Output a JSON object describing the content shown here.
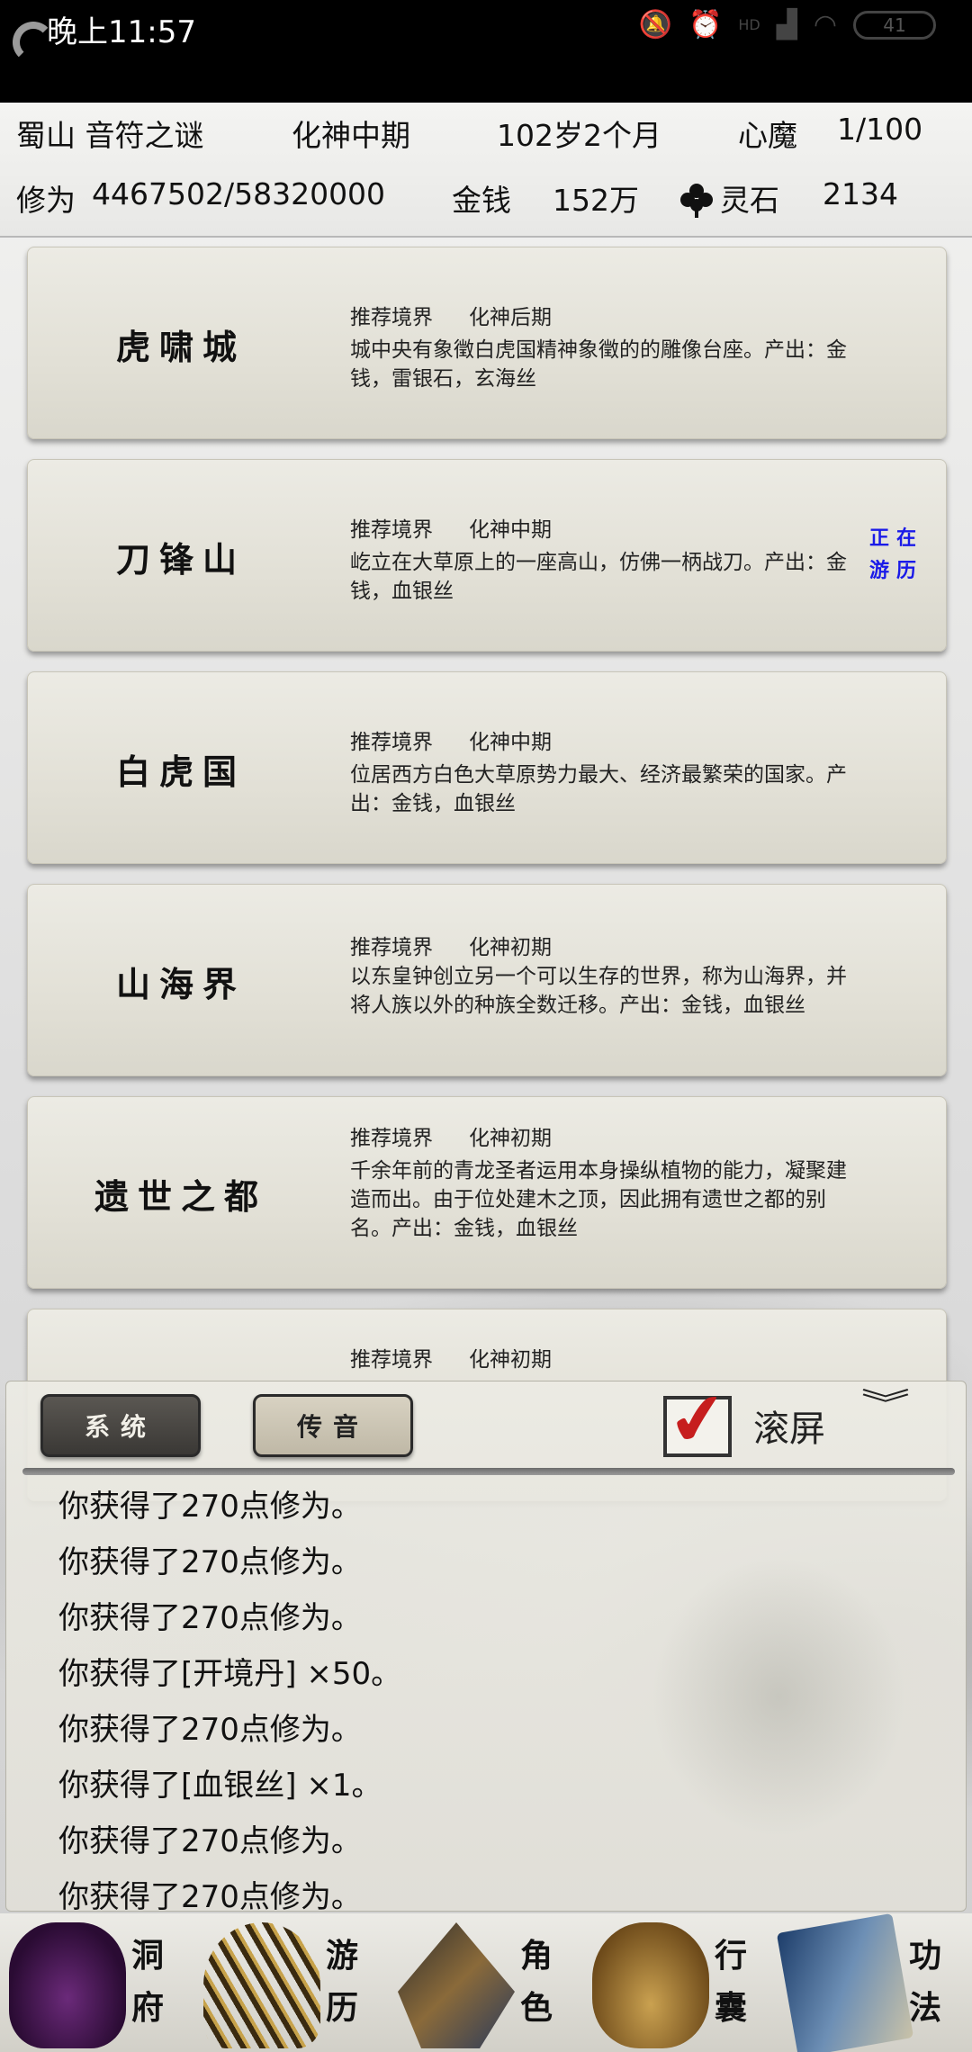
{
  "status_bar": {
    "time": "晚上11:57",
    "network_label": "HD",
    "battery": "41"
  },
  "player": {
    "location": "蜀山 音符之谜",
    "realm": "化神中期",
    "age": "102岁2个月",
    "heart_demon_label": "心魔",
    "heart_demon_value": "1/100",
    "cultivation_label": "修为",
    "cultivation_value": "4467502/58320000",
    "money_label": "金钱",
    "money_value": "152万",
    "spirit_stone_label": "灵石",
    "spirit_stone_value": "2134"
  },
  "cards": [
    {
      "name": "虎啸城",
      "rec_label": "推荐境界",
      "rec_level": "化神后期",
      "desc": "城中央有象徵白虎国精神象徵的的雕像台座。产出：金钱，雷银石，玄海丝",
      "visiting": ""
    },
    {
      "name": "刀锋山",
      "rec_label": "推荐境界",
      "rec_level": "化神中期",
      "desc": "屹立在大草原上的一座高山，仿佛一柄战刀。产出：金钱，血银丝",
      "visiting": "正在游历"
    },
    {
      "name": "白虎国",
      "rec_label": "推荐境界",
      "rec_level": "化神中期",
      "desc": "位居西方白色大草原势力最大、经济最繁荣的国家。产出：金钱，血银丝",
      "visiting": ""
    },
    {
      "name": "山海界",
      "rec_label": "推荐境界",
      "rec_level": "化神初期",
      "desc": "以东皇钟创立另一个可以生存的世界，称为山海界，并将人族以外的种族全数迁移。产出：金钱，血银丝",
      "visiting": ""
    },
    {
      "name": "遗世之都",
      "rec_label": "推荐境界",
      "rec_level": "化神初期",
      "desc": "千余年前的青龙圣者运用本身操纵植物的能力，凝聚建造而出。由于位处建木之顶，因此拥有遗世之都的别名。产出：金钱，血银丝",
      "visiting": ""
    },
    {
      "name": "",
      "rec_label": "推荐境界",
      "rec_level": "化神初期",
      "desc": "",
      "visiting": ""
    }
  ],
  "panel": {
    "system_tab": "系统",
    "voice_tab": "传音",
    "scroll_label": "滚屏",
    "scroll_checked": true,
    "messages": [
      "你获得了270点修为。",
      "你获得了270点修为。",
      "你获得了270点修为。",
      "你获得了[开境丹] ×50。",
      "你获得了270点修为。",
      "你获得了[血银丝] ×1。",
      "你获得了270点修为。",
      "你获得了270点修为。"
    ]
  },
  "nav": [
    {
      "label": "洞府",
      "icon": "treasure-bag-icon"
    },
    {
      "label": "游历",
      "icon": "brush-icon"
    },
    {
      "label": "角色",
      "icon": "straw-hat-icon"
    },
    {
      "label": "行囊",
      "icon": "sack-icon"
    },
    {
      "label": "功法",
      "icon": "book-icon"
    }
  ],
  "colors": {
    "visiting_text": "#1a1ae8",
    "checkmark": "#c61e1e",
    "system_tab_bg": "#3a3835"
  }
}
